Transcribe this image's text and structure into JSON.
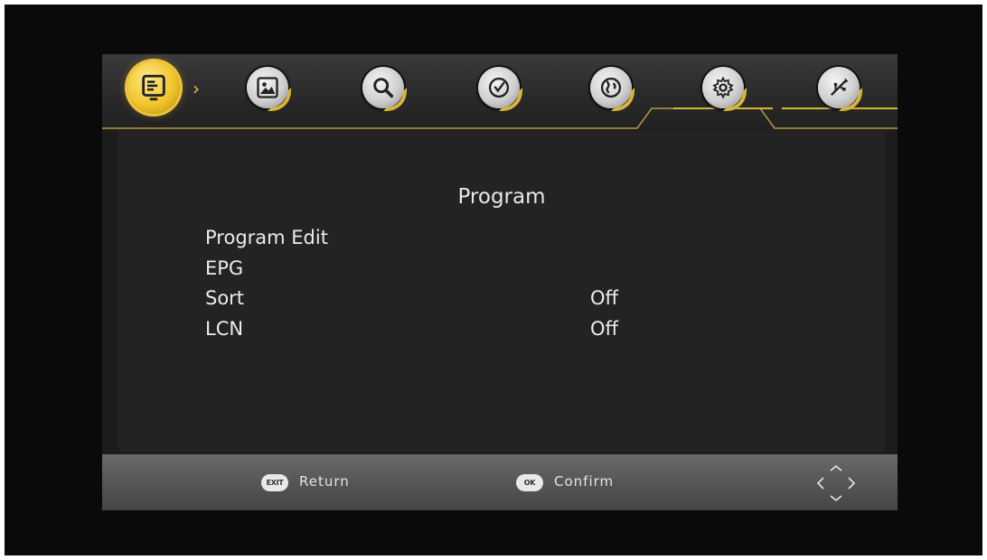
{
  "colors": {
    "accent": "#f0c53a",
    "panel": "#232323",
    "bar": "#565656",
    "text": "#ececec"
  },
  "tabs": [
    {
      "icon": "monitor-icon",
      "active": true
    },
    {
      "icon": "picture-icon",
      "active": false
    },
    {
      "icon": "search-icon",
      "active": false
    },
    {
      "icon": "clock-icon",
      "active": false
    },
    {
      "icon": "globe-icon",
      "active": false
    },
    {
      "icon": "gear-icon",
      "active": false
    },
    {
      "icon": "usb-icon",
      "active": false
    }
  ],
  "page": {
    "title": "Program"
  },
  "menu": {
    "items": [
      {
        "label": "Program Edit",
        "value": ""
      },
      {
        "label": "EPG",
        "value": ""
      },
      {
        "label": "Sort",
        "value": "Off"
      },
      {
        "label": "LCN",
        "value": "Off"
      }
    ]
  },
  "footer": {
    "return_key": "EXIT",
    "return_label": "Return",
    "confirm_key": "OK",
    "confirm_label": "Confirm",
    "nav_icon": "dpad-icon"
  }
}
